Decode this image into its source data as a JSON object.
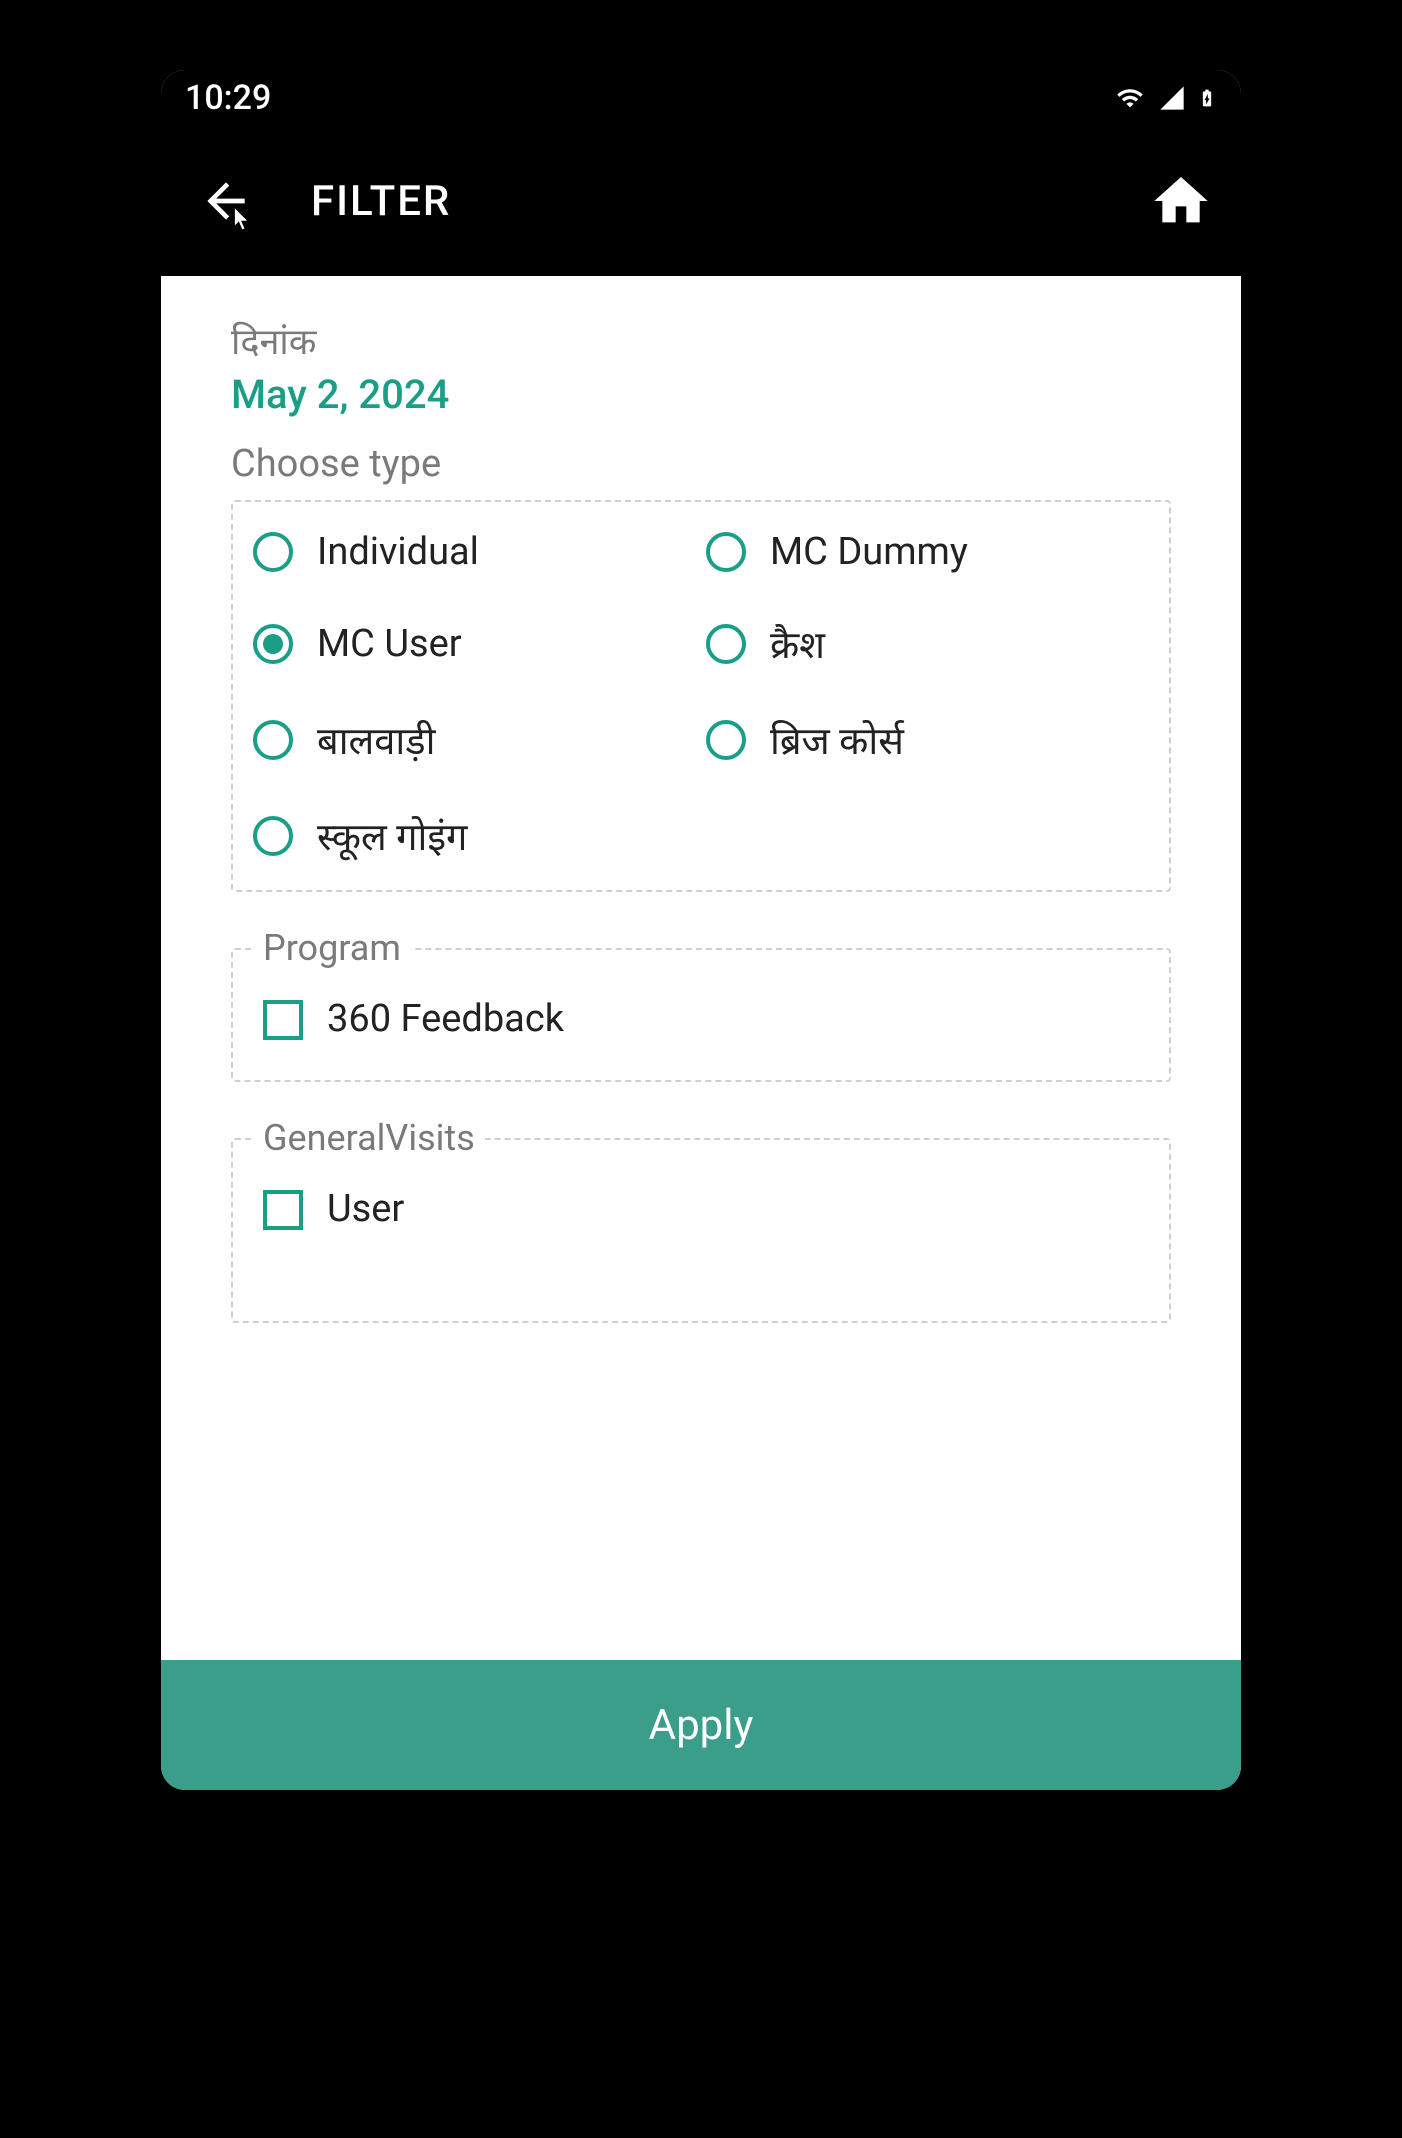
{
  "status": {
    "time": "10:29"
  },
  "appbar": {
    "title": "FILTER"
  },
  "date_section": {
    "label": "दिनांक",
    "value": "May 2, 2024"
  },
  "type_section": {
    "label": "Choose type",
    "options": [
      {
        "label": "Individual",
        "selected": false
      },
      {
        "label": "MC Dummy",
        "selected": false
      },
      {
        "label": "MC User",
        "selected": true
      },
      {
        "label": "क्रैश",
        "selected": false
      },
      {
        "label": "बालवाड़ी",
        "selected": false
      },
      {
        "label": "ब्रिज कोर्स",
        "selected": false
      },
      {
        "label": "स्कूल गोइंग",
        "selected": false
      }
    ]
  },
  "program_section": {
    "label": "Program",
    "options": [
      {
        "label": "360 Feedback",
        "checked": false
      }
    ]
  },
  "general_section": {
    "label": "GeneralVisits",
    "options": [
      {
        "label": "User",
        "checked": false
      }
    ]
  },
  "apply_label": "Apply",
  "colors": {
    "accent": "#1b9e86",
    "apply_bg": "#3a9e8b"
  }
}
